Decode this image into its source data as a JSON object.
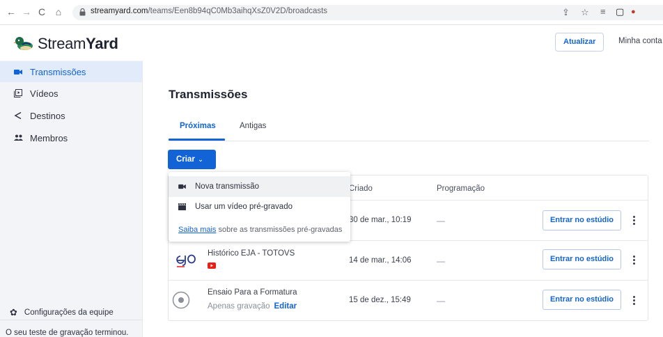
{
  "browser": {
    "url_domain": "streamyard.com",
    "url_path": "/teams/Een8b94qC0Mb3aihqXsZ0V2D/broadcasts"
  },
  "header": {
    "brand_light": "Stream",
    "brand_bold": "Yard",
    "update_button": "Atualizar",
    "account": "Minha conta"
  },
  "sidebar": {
    "items": [
      {
        "label": "Transmissões",
        "icon": "camera-icon"
      },
      {
        "label": "Vídeos",
        "icon": "video-library-icon"
      },
      {
        "label": "Destinos",
        "icon": "share-icon"
      },
      {
        "label": "Membros",
        "icon": "people-icon"
      }
    ],
    "team_settings": "Configurações da equipe",
    "trial_notice": "O seu teste de gravação terminou."
  },
  "main": {
    "title": "Transmissões",
    "tabs": [
      "Próximas",
      "Antigas"
    ],
    "create_button": "Criar",
    "columns": [
      "Criado",
      "Programação"
    ],
    "rows": [
      {
        "title": "",
        "created": "30 de mar., 10:19",
        "schedule": "—",
        "action": "Entrar no estúdio"
      },
      {
        "title": "Histórico EJA - TOTOVS",
        "created": "14 de mar., 14:06",
        "schedule": "—",
        "action": "Entrar no estúdio"
      },
      {
        "title": "Ensaio Para a Formatura",
        "subtitle": "Apenas gravação",
        "edit": "Editar",
        "created": "15 de dez., 15:49",
        "schedule": "—",
        "action": "Entrar no estúdio"
      }
    ]
  },
  "menu": {
    "items": [
      "Nova transmissão",
      "Usar um vídeo pré-gravado"
    ],
    "footer_link": "Saiba mais",
    "footer_text": " sobre as transmissões pré-gravadas"
  },
  "colors": {
    "accent": "#1264d6",
    "sidebar_bg": "#f2f4f7",
    "active_bg": "#e1ebfa",
    "youtube": "#e62117"
  }
}
